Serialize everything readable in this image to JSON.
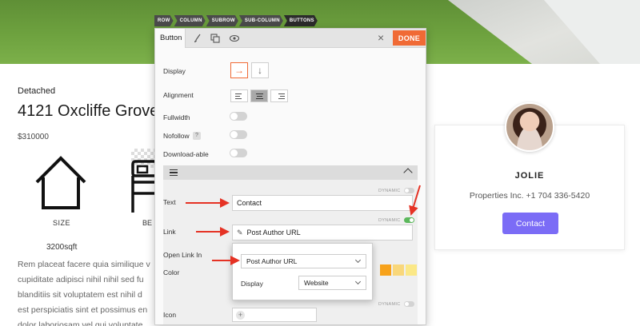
{
  "breadcrumb": [
    "ROW",
    "COLUMN",
    "SUBROW",
    "SUB-COLUMN",
    "BUTTONS"
  ],
  "page": {
    "property_type": "Detached",
    "title": "4121 Oxcliffe Grove",
    "price": "$310000",
    "size_label": "SIZE",
    "bed_label": "BE",
    "size_value": "3200sqft",
    "description_lines": [
      "Rem placeat facere quia similique v",
      "cupiditate adipisci nihil nihil sed fu",
      "blanditiis sit voluptatem est nihil d",
      "est perspiciatis sint et possimus en",
      "dolor laboriosam vel qui voluptate"
    ]
  },
  "agent": {
    "name": "JOLIE",
    "phone": "Properties Inc. +1 704 336-5420",
    "button": "Contact",
    "accent": "#7b6cf6"
  },
  "panel": {
    "tab_label": "Button",
    "tab_icons": [
      "brush-icon",
      "layers-icon",
      "eye-icon"
    ],
    "close_icon": "×",
    "done_label": "DONE",
    "done_color": "#f06a35",
    "display_label": "Display",
    "display_options": [
      "→",
      "↓"
    ],
    "alignment_label": "Alignment",
    "fullwidth_label": "Fullwidth",
    "nofollow_label": "Nofollow",
    "downloadable_label": "Download-able",
    "help_mark": "?",
    "dynamic_label": "DYNAMIC",
    "text_label": "Text",
    "text_value": "Contact",
    "link_label": "Link",
    "link_value": "Post Author URL",
    "open_link_label": "Open Link In",
    "color_label": "Color",
    "icon_label": "Icon",
    "swatches": [
      "#f7a21b",
      "#f9d77a",
      "#fbe887"
    ],
    "toggles": {
      "fullwidth": false,
      "nofollow": false,
      "downloadable": false,
      "link_dynamic": true
    }
  },
  "popup": {
    "source_value": "Post Author URL",
    "display_label": "Display",
    "display_value": "Website"
  }
}
